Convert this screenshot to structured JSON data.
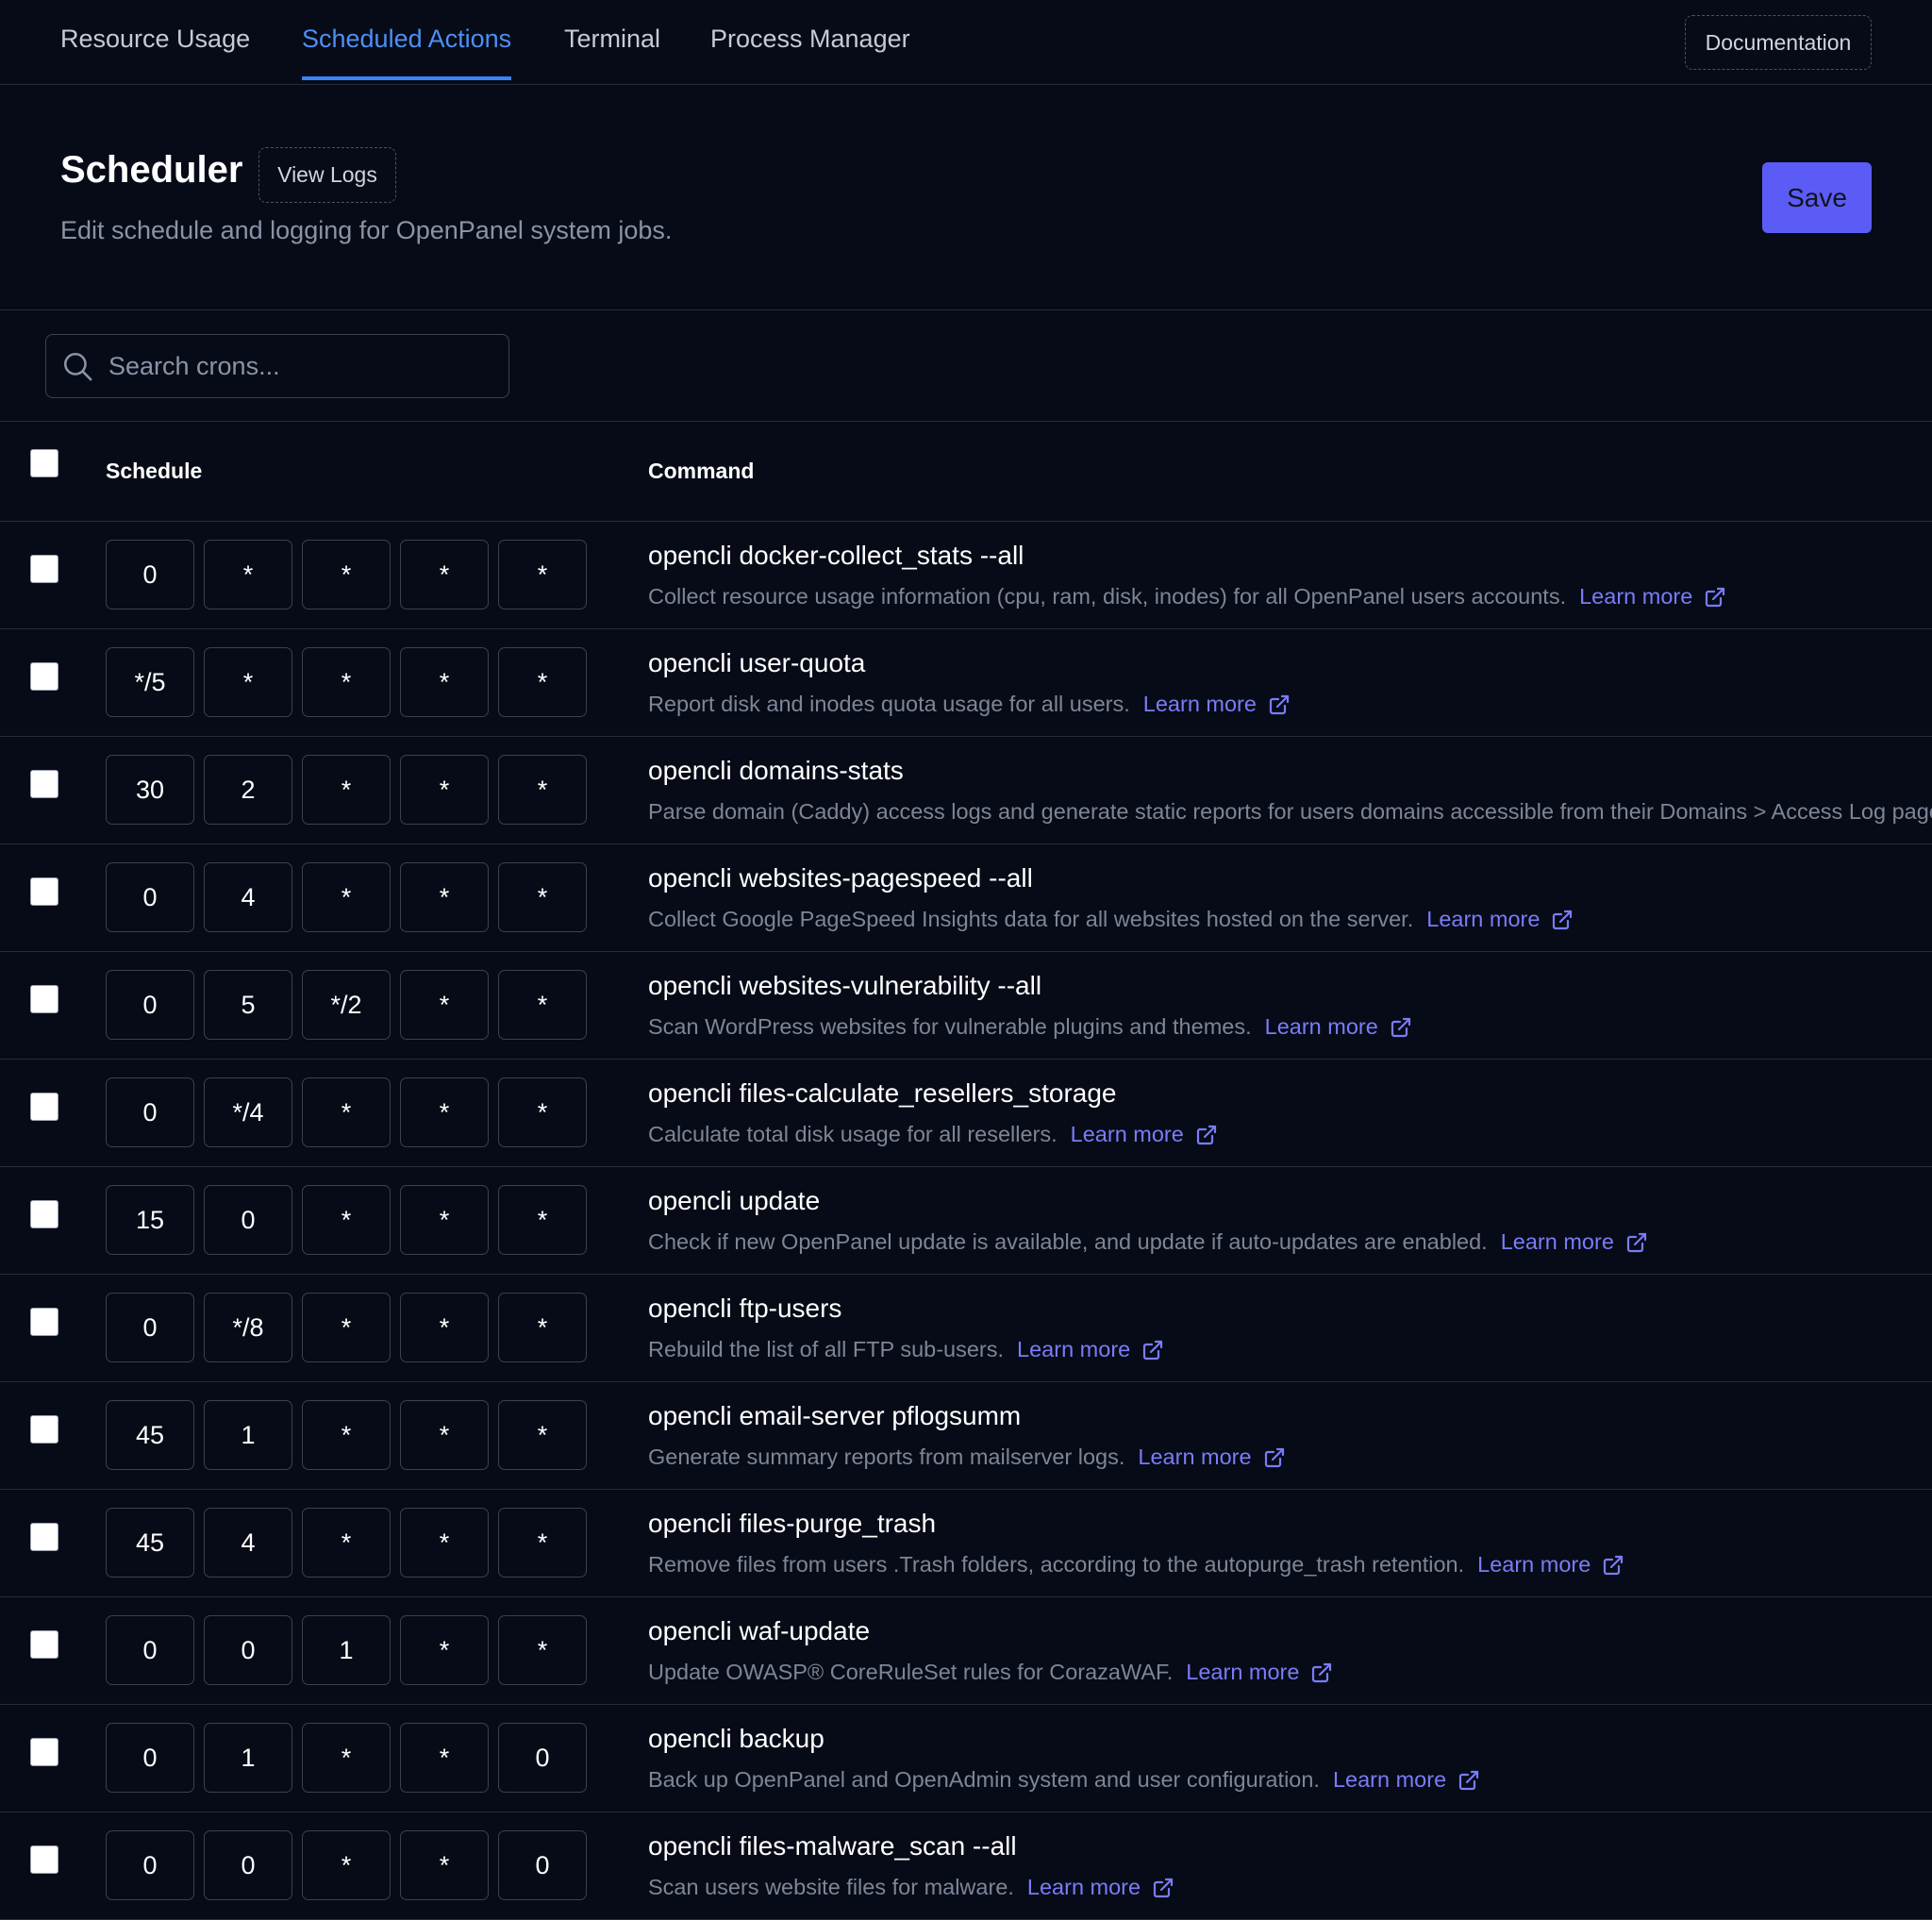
{
  "tabs": [
    {
      "label": "Resource Usage"
    },
    {
      "label": "Scheduled Actions"
    },
    {
      "label": "Terminal"
    },
    {
      "label": "Process Manager"
    }
  ],
  "active_tab": "Scheduled Actions",
  "documentation_label": "Documentation",
  "header": {
    "title": "Scheduler",
    "view_logs_label": "View Logs",
    "subtitle": "Edit schedule and logging for OpenPanel system jobs.",
    "save_label": "Save"
  },
  "search": {
    "placeholder": "Search crons..."
  },
  "table": {
    "columns": {
      "schedule": "Schedule",
      "command": "Command"
    },
    "learn_more_label": "Learn more",
    "rows": [
      {
        "schedule": [
          "0",
          "*",
          "*",
          "*",
          "*"
        ],
        "command": "opencli docker-collect_stats --all",
        "description": "Collect resource usage information (cpu, ram, disk, inodes) for all OpenPanel users accounts.",
        "learn_more": true
      },
      {
        "schedule": [
          "*/5",
          "*",
          "*",
          "*",
          "*"
        ],
        "command": "opencli user-quota",
        "description": "Report disk and inodes quota usage for all users.",
        "learn_more": true
      },
      {
        "schedule": [
          "30",
          "2",
          "*",
          "*",
          "*"
        ],
        "command": "opencli domains-stats",
        "description": "Parse domain (Caddy) access logs and generate static reports for users domains accessible from their Domains > Access Log page.",
        "learn_more": false
      },
      {
        "schedule": [
          "0",
          "4",
          "*",
          "*",
          "*"
        ],
        "command": "opencli websites-pagespeed --all",
        "description": "Collect Google PageSpeed Insights data for all websites hosted on the server.",
        "learn_more": true
      },
      {
        "schedule": [
          "0",
          "5",
          "*/2",
          "*",
          "*"
        ],
        "command": "opencli websites-vulnerability --all",
        "description": "Scan WordPress websites for vulnerable plugins and themes.",
        "learn_more": true
      },
      {
        "schedule": [
          "0",
          "*/4",
          "*",
          "*",
          "*"
        ],
        "command": "opencli files-calculate_resellers_storage",
        "description": "Calculate total disk usage for all resellers.",
        "learn_more": true
      },
      {
        "schedule": [
          "15",
          "0",
          "*",
          "*",
          "*"
        ],
        "command": "opencli update",
        "description": "Check if new OpenPanel update is available, and update if auto-updates are enabled.",
        "learn_more": true
      },
      {
        "schedule": [
          "0",
          "*/8",
          "*",
          "*",
          "*"
        ],
        "command": "opencli ftp-users",
        "description": "Rebuild the list of all FTP sub-users.",
        "learn_more": true
      },
      {
        "schedule": [
          "45",
          "1",
          "*",
          "*",
          "*"
        ],
        "command": "opencli email-server pflogsumm",
        "description": "Generate summary reports from mailserver logs.",
        "learn_more": true
      },
      {
        "schedule": [
          "45",
          "4",
          "*",
          "*",
          "*"
        ],
        "command": "opencli files-purge_trash",
        "description": "Remove files from users .Trash folders, according to the autopurge_trash retention.",
        "learn_more": true
      },
      {
        "schedule": [
          "0",
          "0",
          "1",
          "*",
          "*"
        ],
        "command": "opencli waf-update",
        "description": "Update OWASP® CoreRuleSet rules for CorazaWAF.",
        "learn_more": true
      },
      {
        "schedule": [
          "0",
          "1",
          "*",
          "*",
          "0"
        ],
        "command": "opencli backup",
        "description": "Back up OpenPanel and OpenAdmin system and user configuration.",
        "learn_more": true
      },
      {
        "schedule": [
          "0",
          "0",
          "*",
          "*",
          "0"
        ],
        "command": "opencli files-malware_scan --all",
        "description": "Scan users website files for malware.",
        "learn_more": true
      }
    ]
  },
  "colors": {
    "background": "#060b17",
    "accent": "#3b82f6",
    "save_button": "#5b5cf6",
    "link": "#7b7cf8"
  }
}
